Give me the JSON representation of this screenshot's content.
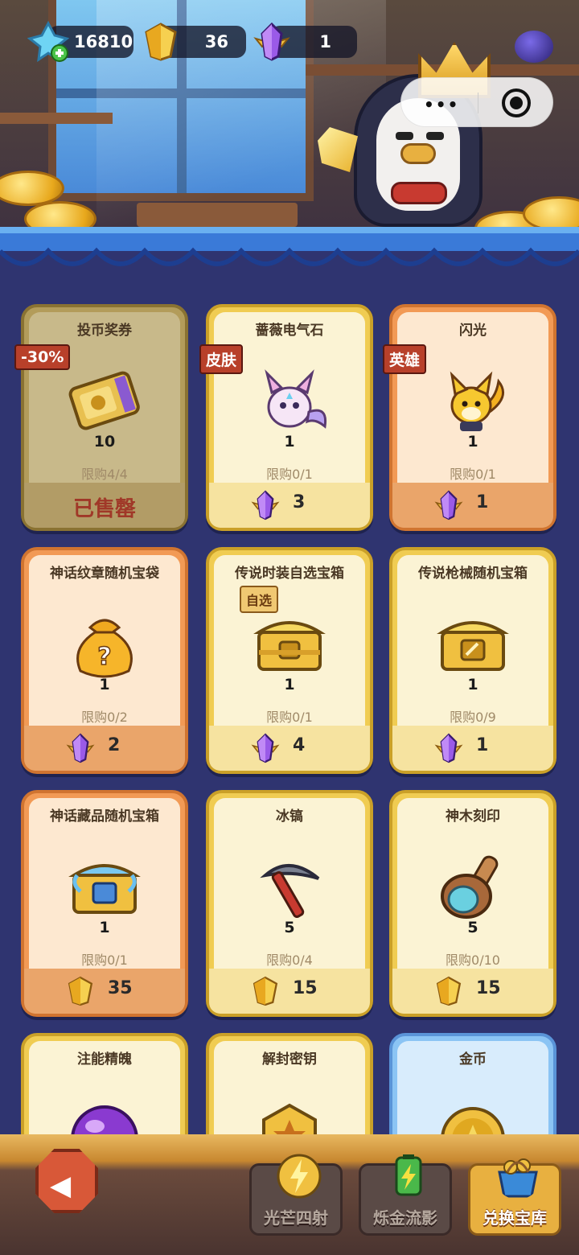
{
  "resources": [
    {
      "icon": "blue-diamond-plus-icon",
      "value": "16810"
    },
    {
      "icon": "gold-crystal-icon",
      "value": "36"
    },
    {
      "icon": "purple-crystal-icon",
      "value": "1"
    }
  ],
  "shop": {
    "items": [
      {
        "name": "投币奖券",
        "tag": "-30%",
        "count": "10",
        "limit": "限购4/4",
        "sold_out": "已售罄",
        "item_icon": "ticket-icon",
        "theme": "sold"
      },
      {
        "name": "蔷薇电气石",
        "tag": "皮肤",
        "count": "1",
        "limit": "限购0/1",
        "currency_icon": "purple-crystal-icon",
        "price": "3",
        "item_icon": "skin-creature-icon",
        "theme": "gold"
      },
      {
        "name": "闪光",
        "tag": "英雄",
        "count": "1",
        "limit": "限购0/1",
        "currency_icon": "purple-crystal-icon",
        "price": "1",
        "item_icon": "hero-fox-icon",
        "theme": "orange"
      },
      {
        "name": "神话纹章随机宝袋",
        "count": "1",
        "limit": "限购0/2",
        "currency_icon": "purple-crystal-icon",
        "price": "2",
        "item_icon": "mystery-bag-icon",
        "theme": "orange"
      },
      {
        "name": "传说时装自选宝箱",
        "tag": "自选",
        "count": "1",
        "limit": "限购0/1",
        "currency_icon": "purple-crystal-icon",
        "price": "4",
        "item_icon": "gold-chest-icon",
        "theme": "gold"
      },
      {
        "name": "传说枪械随机宝箱",
        "count": "1",
        "limit": "限购0/9",
        "currency_icon": "purple-crystal-icon",
        "price": "1",
        "item_icon": "gold-chest-icon",
        "theme": "gold"
      },
      {
        "name": "神话藏品随机宝箱",
        "count": "1",
        "limit": "限购0/1",
        "currency_icon": "gold-crystal-icon",
        "price": "35",
        "item_icon": "blue-chest-icon",
        "theme": "orange"
      },
      {
        "name": "冰镐",
        "count": "5",
        "limit": "限购0/4",
        "currency_icon": "gold-crystal-icon",
        "price": "15",
        "item_icon": "pickaxe-icon",
        "theme": "gold"
      },
      {
        "name": "神木刻印",
        "count": "5",
        "limit": "限购0/10",
        "currency_icon": "gold-crystal-icon",
        "price": "15",
        "item_icon": "wood-stamp-icon",
        "theme": "gold"
      },
      {
        "name": "注能精魄",
        "item_icon": "purple-orb-icon",
        "theme": "gold"
      },
      {
        "name": "解封密钥",
        "item_icon": "key-hexagon-icon",
        "theme": "gold"
      },
      {
        "name": "金币",
        "item_icon": "gold-coin-icon",
        "theme": "blue"
      }
    ]
  },
  "bottom_nav": {
    "back_icon": "back-arrow-icon",
    "tabs": [
      {
        "label": "光芒四射",
        "icon": "lightning-orb-icon",
        "active": false
      },
      {
        "label": "烁金流影",
        "icon": "battery-icon",
        "active": false
      },
      {
        "label": "兑换宝库",
        "icon": "treasure-basket-icon",
        "active": true
      }
    ]
  },
  "colors": {
    "gold_card": "#f0cc52",
    "orange_card": "#f29a55",
    "blue_card": "#8bc4f4",
    "background": "#2f3470"
  }
}
